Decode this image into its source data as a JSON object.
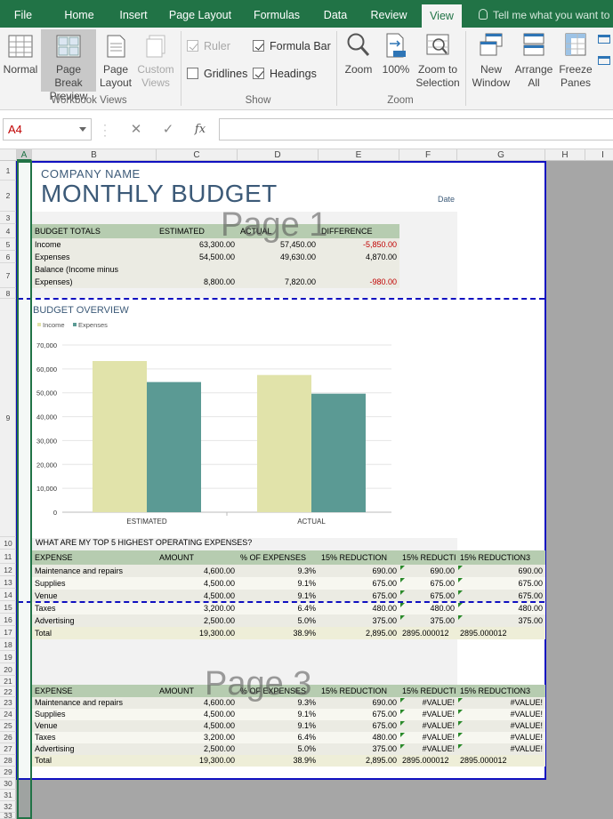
{
  "ribbon_tabs": [
    {
      "label": "File"
    },
    {
      "label": "Home"
    },
    {
      "label": "Insert"
    },
    {
      "label": "Page Layout"
    },
    {
      "label": "Formulas"
    },
    {
      "label": "Data"
    },
    {
      "label": "Review"
    },
    {
      "label": "View",
      "active": true
    }
  ],
  "tell_me": "Tell me what you want to",
  "workbook_views": {
    "group_label": "Workbook Views",
    "normal": "Normal",
    "page_break_1": "Page Break",
    "page_break_2": "Preview",
    "page_layout_1": "Page",
    "page_layout_2": "Layout",
    "custom_1": "Custom",
    "custom_2": "Views"
  },
  "show": {
    "group_label": "Show",
    "ruler": {
      "label": "Ruler",
      "checked": true,
      "disabled": true
    },
    "gridlines": {
      "label": "Gridlines",
      "checked": false
    },
    "formula_bar": {
      "label": "Formula Bar",
      "checked": true
    },
    "headings": {
      "label": "Headings",
      "checked": true
    }
  },
  "zoom": {
    "group_label": "Zoom",
    "zoom": "Zoom",
    "hundred": "100%",
    "zoom_to_1": "Zoom to",
    "zoom_to_2": "Selection"
  },
  "window": {
    "new_1": "New",
    "new_2": "Window",
    "arrange_1": "Arrange",
    "arrange_2": "All",
    "freeze_1": "Freeze",
    "freeze_2": "Panes"
  },
  "formula_bar": {
    "name_box": "A4",
    "cancel": "✕",
    "enter": "✓",
    "fx": "fx",
    "value": ""
  },
  "columns": [
    "A",
    "B",
    "C",
    "D",
    "E",
    "F",
    "G",
    "H",
    "I"
  ],
  "rows": [
    "1",
    "2",
    "3",
    "4",
    "5",
    "6",
    "7",
    "8",
    "9",
    "10",
    "11",
    "12",
    "13",
    "14",
    "15",
    "16",
    "17",
    "18",
    "19",
    "20",
    "21",
    "22",
    "23",
    "24",
    "25",
    "26",
    "27",
    "28",
    "29",
    "30",
    "31",
    "32",
    "33"
  ],
  "sheet": {
    "company": "COMPANY NAME",
    "title": "MONTHLY BUDGET",
    "date_label": "Date",
    "page1_watermark": "Page 1",
    "page3_watermark": "Page 3",
    "budget_totals": {
      "headers": [
        "BUDGET TOTALS",
        "ESTIMATED",
        "ACTUAL",
        "DIFFERENCE"
      ],
      "rows": [
        [
          "Income",
          "63,300.00",
          "57,450.00",
          "-5,850.00"
        ],
        [
          "Expenses",
          "54,500.00",
          "49,630.00",
          "4,870.00"
        ],
        [
          "Balance (Income minus",
          "",
          "",
          ""
        ],
        [
          "Expenses)",
          "8,800.00",
          "7,820.00",
          "-980.00"
        ]
      ]
    },
    "overview_title": "BUDGET OVERVIEW",
    "top5_title": "WHAT ARE MY TOP 5 HIGHEST OPERATING EXPENSES?",
    "expenses1": {
      "headers": [
        "EXPENSE",
        "AMOUNT",
        "% OF EXPENSES",
        "15% REDUCTION",
        "15% REDUCTI",
        "15% REDUCTION3"
      ],
      "rows": [
        [
          "Maintenance and repairs",
          "4,600.00",
          "9.3%",
          "690.00",
          "690.00",
          "690.00"
        ],
        [
          "Supplies",
          "4,500.00",
          "9.1%",
          "675.00",
          "675.00",
          "675.00"
        ],
        [
          "Venue",
          "4,500.00",
          "9.1%",
          "675.00",
          "675.00",
          "675.00"
        ],
        [
          "Taxes",
          "3,200.00",
          "6.4%",
          "480.00",
          "480.00",
          "480.00"
        ],
        [
          "Advertising",
          "2,500.00",
          "5.0%",
          "375.00",
          "375.00",
          "375.00"
        ],
        [
          "Total",
          "19,300.00",
          "38.9%",
          "2,895.00",
          "2895.000012",
          "2895.000012"
        ]
      ]
    },
    "expenses2": {
      "headers": [
        "EXPENSE",
        "AMOUNT",
        "% OF EXPENSES",
        "15% REDUCTION",
        "15% REDUCTI",
        "15% REDUCTION3"
      ],
      "rows": [
        [
          "Maintenance and repairs",
          "4,600.00",
          "9.3%",
          "690.00",
          "#VALUE!",
          "#VALUE!"
        ],
        [
          "Supplies",
          "4,500.00",
          "9.1%",
          "675.00",
          "#VALUE!",
          "#VALUE!"
        ],
        [
          "Venue",
          "4,500.00",
          "9.1%",
          "675.00",
          "#VALUE!",
          "#VALUE!"
        ],
        [
          "Taxes",
          "3,200.00",
          "6.4%",
          "480.00",
          "#VALUE!",
          "#VALUE!"
        ],
        [
          "Advertising",
          "2,500.00",
          "5.0%",
          "375.00",
          "#VALUE!",
          "#VALUE!"
        ],
        [
          "Total",
          "19,300.00",
          "38.9%",
          "2,895.00",
          "2895.000012",
          "2895.000012"
        ]
      ]
    }
  },
  "chart_data": {
    "type": "bar",
    "title": "",
    "categories": [
      "ESTIMATED",
      "ACTUAL"
    ],
    "series": [
      {
        "name": "Income",
        "values": [
          63300,
          57450
        ],
        "color": "#e1e3aa"
      },
      {
        "name": "Expenses",
        "values": [
          54500,
          49630
        ],
        "color": "#5b9a94"
      }
    ],
    "ylim": [
      0,
      70000
    ],
    "yticks": [
      "0",
      "10,000",
      "20,000",
      "30,000",
      "40,000",
      "50,000",
      "60,000",
      "70,000"
    ],
    "grid": true,
    "legend": "top-left"
  }
}
